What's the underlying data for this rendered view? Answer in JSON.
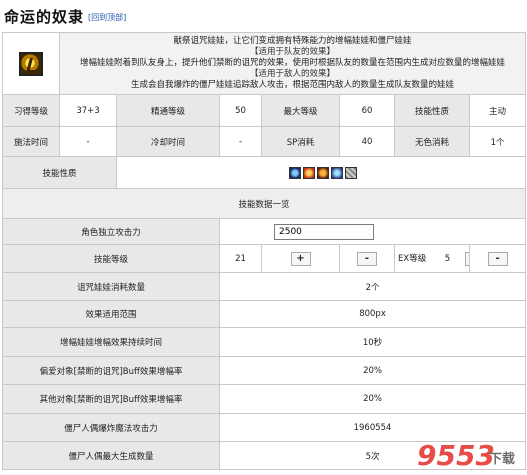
{
  "header": {
    "title": "命运的奴隶",
    "back_link": "[回到顶部]"
  },
  "skill": {
    "icon": "golden-skull-skill-icon",
    "description": {
      "intro": "献祭诅咒娃娃，让它们变成拥有特殊能力的增幅娃娃和僵尸娃娃",
      "ally_heading": "【适用于队友的效果】",
      "ally_text": "增幅娃娃附着到队友身上，提升他们禁断的诅咒的效果，使用时根据队友的数量在范围内生成对应数量的增幅娃娃",
      "enemy_heading": "【适用于敌人的效果】",
      "enemy_text": "生成会自我爆炸的僵尸娃娃追踪敌人攻击，根据范围内敌人的数量生成队友数量的娃娃"
    },
    "row1": {
      "learn_level_label": "习得等级",
      "learn_level_value": "37+3",
      "mastery_label": "精通等级",
      "mastery_value": "50",
      "max_level_label": "最大等级",
      "max_level_value": "60",
      "skill_type_label": "技能性质",
      "skill_type_value": "主动"
    },
    "row2": {
      "cast_time_label": "施法时间",
      "cast_time_value": "-",
      "cooldown_label": "冷却时间",
      "cooldown_value": "-",
      "sp_label": "SP消耗",
      "sp_value": "40",
      "colorless_label": "无色消耗",
      "colorless_value": "1个"
    },
    "properties_label": "技能性质",
    "property_icons": [
      "blue-orb-icon",
      "fire-burst-icon",
      "flame-swirl-icon",
      "blue-flash-icon",
      "gray-pattern-icon"
    ]
  },
  "data_section": {
    "title": "技能数据一览",
    "attack_label": "角色独立攻击力",
    "attack_value": "2500",
    "skill_level_label": "技能等级",
    "skill_level_value": "21",
    "ex_level_label": "EX等级",
    "ex_level_value": "5",
    "plus": "+",
    "minus": "-",
    "stats": [
      {
        "label": "诅咒娃娃消耗数量",
        "value": "2个"
      },
      {
        "label": "效果适用范围",
        "value": "800px"
      },
      {
        "label": "增幅娃娃增幅效果持续时间",
        "value": "10秒"
      },
      {
        "label": "偏爱对象[禁断的诅咒]Buff效果增幅率",
        "value": "20%"
      },
      {
        "label": "其他对象[禁断的诅咒]Buff效果增幅率",
        "value": "20%"
      },
      {
        "label": "僵尸人偶爆炸魔法攻击力",
        "value": "1960554"
      },
      {
        "label": "僵尸人偶最大生成数量",
        "value": "5次"
      }
    ]
  },
  "watermark": {
    "text": "9553",
    "suffix": "下载",
    "color": "#e53935"
  }
}
